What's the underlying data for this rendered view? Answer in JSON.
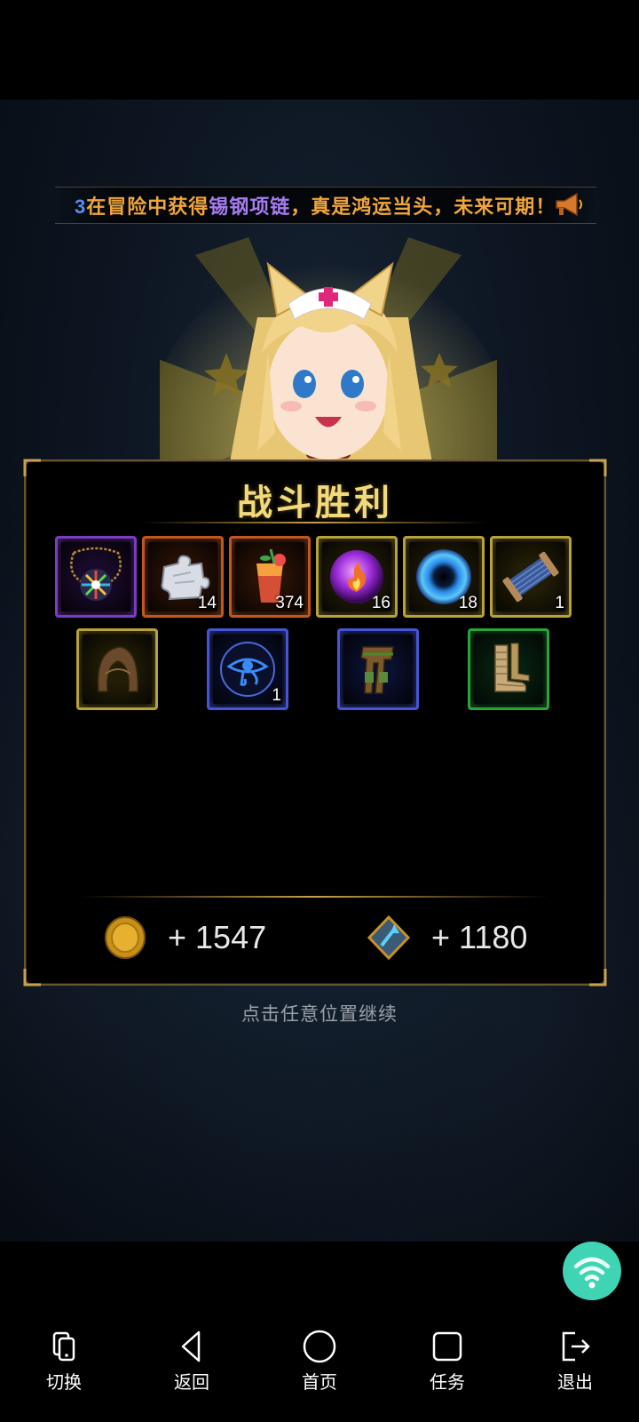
{
  "ticker": {
    "prefix_fragment": "3",
    "text_before": "在冒险中获得",
    "item_name": "锡钢项链",
    "text_after": "，真是鸿运当头，未来可期！"
  },
  "result": {
    "title": "战斗胜利",
    "items_row1": [
      {
        "icon": "gem-necklace-icon",
        "rarity": "purple",
        "qty": ""
      },
      {
        "icon": "puzzle-piece-icon",
        "rarity": "orange",
        "qty": "14"
      },
      {
        "icon": "fruit-drink-icon",
        "rarity": "orange",
        "qty": "374"
      },
      {
        "icon": "fire-orb-icon",
        "rarity": "gold",
        "qty": "16"
      },
      {
        "icon": "void-orb-icon",
        "rarity": "gold",
        "qty": "18"
      },
      {
        "icon": "thread-spool-icon",
        "rarity": "gold",
        "qty": "1"
      }
    ],
    "items_row2": [
      {
        "icon": "leather-hood-icon",
        "rarity": "gold",
        "qty": ""
      },
      {
        "icon": "eye-rune-icon",
        "rarity": "blue",
        "qty": "1"
      },
      {
        "icon": "leg-armor-icon",
        "rarity": "blue",
        "qty": ""
      },
      {
        "icon": "bandaged-boots-icon",
        "rarity": "green",
        "qty": ""
      }
    ],
    "gold_reward": "+ 1547",
    "exp_reward": "+ 1180"
  },
  "continue_hint": "点击任意位置继续",
  "navbar": {
    "switch": "切换",
    "back": "返回",
    "home": "首页",
    "tasks": "任务",
    "exit": "退出"
  },
  "colors": {
    "title_gold": "#f2d97a",
    "fab_teal": "#3ed4b4",
    "ticker_orange": "#f0a53c",
    "ticker_purple": "#a77cf0"
  }
}
